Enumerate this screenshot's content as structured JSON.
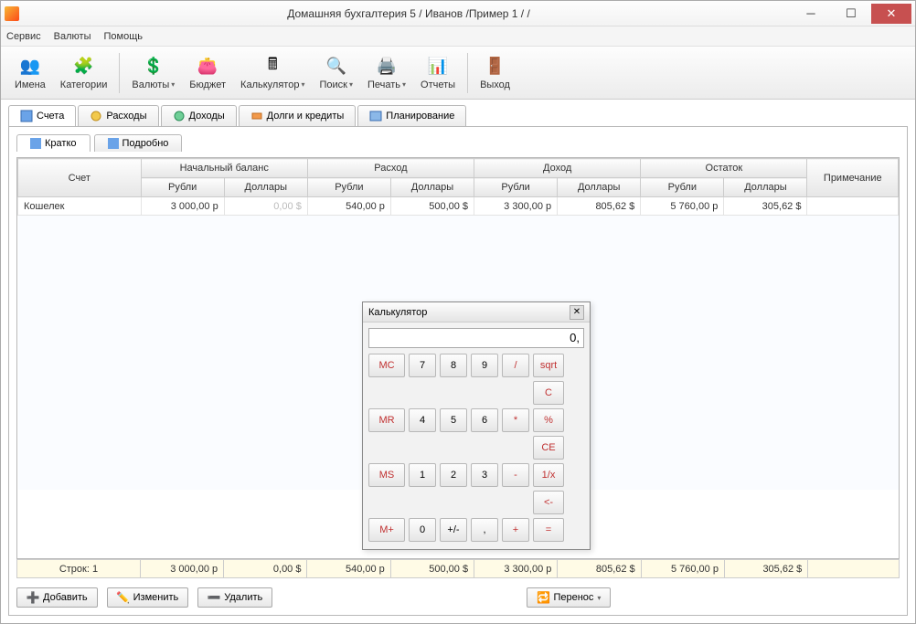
{
  "window": {
    "title": "Домашняя бухгалтерия 5  / Иванов /Пример 1 / /"
  },
  "menu": {
    "service": "Сервис",
    "currency": "Валюты",
    "help": "Помощь"
  },
  "toolbar": {
    "names": "Имена",
    "categories": "Категории",
    "currencies": "Валюты",
    "budget": "Бюджет",
    "calculator": "Калькулятор",
    "search": "Поиск",
    "print": "Печать",
    "reports": "Отчеты",
    "exit": "Выход"
  },
  "tabs": {
    "accounts": "Счета",
    "expenses": "Расходы",
    "incomes": "Доходы",
    "debts": "Долги и кредиты",
    "planning": "Планирование"
  },
  "subtabs": {
    "brief": "Кратко",
    "detail": "Подробно"
  },
  "grid": {
    "headers": {
      "account": "Счет",
      "initial": "Начальный баланс",
      "expense": "Расход",
      "income": "Доход",
      "balance": "Остаток",
      "note": "Примечание",
      "rub": "Рубли",
      "usd": "Доллары"
    },
    "row": {
      "account": "Кошелек",
      "init_rub": "3 000,00 р",
      "init_usd": "0,00 $",
      "exp_rub": "540,00 р",
      "exp_usd": "500,00 $",
      "inc_rub": "3 300,00 р",
      "inc_usd": "805,62 $",
      "bal_rub": "5 760,00 р",
      "bal_usd": "305,62 $"
    },
    "totals": {
      "label": "Строк: 1",
      "init_rub": "3 000,00 р",
      "init_usd": "0,00 $",
      "exp_rub": "540,00 р",
      "exp_usd": "500,00 $",
      "inc_rub": "3 300,00 р",
      "inc_usd": "805,62 $",
      "bal_rub": "5 760,00 р",
      "bal_usd": "305,62 $"
    }
  },
  "actions": {
    "add": "Добавить",
    "edit": "Изменить",
    "delete": "Удалить",
    "transfer": "Перенос"
  },
  "calc": {
    "title": "Калькулятор",
    "display": "0,",
    "buttons": [
      [
        "MC",
        "7",
        "8",
        "9",
        "/",
        "sqrt"
      ],
      [
        "",
        "",
        "",
        "",
        "",
        "C"
      ],
      [
        "MR",
        "4",
        "5",
        "6",
        "*",
        "%"
      ],
      [
        "",
        "",
        "",
        "",
        "",
        "CE"
      ],
      [
        "MS",
        "1",
        "2",
        "3",
        "-",
        "1/x"
      ],
      [
        "",
        "",
        "",
        "",
        "",
        "<-"
      ],
      [
        "M+",
        "0",
        "+/-",
        ",",
        "+",
        "="
      ]
    ]
  }
}
